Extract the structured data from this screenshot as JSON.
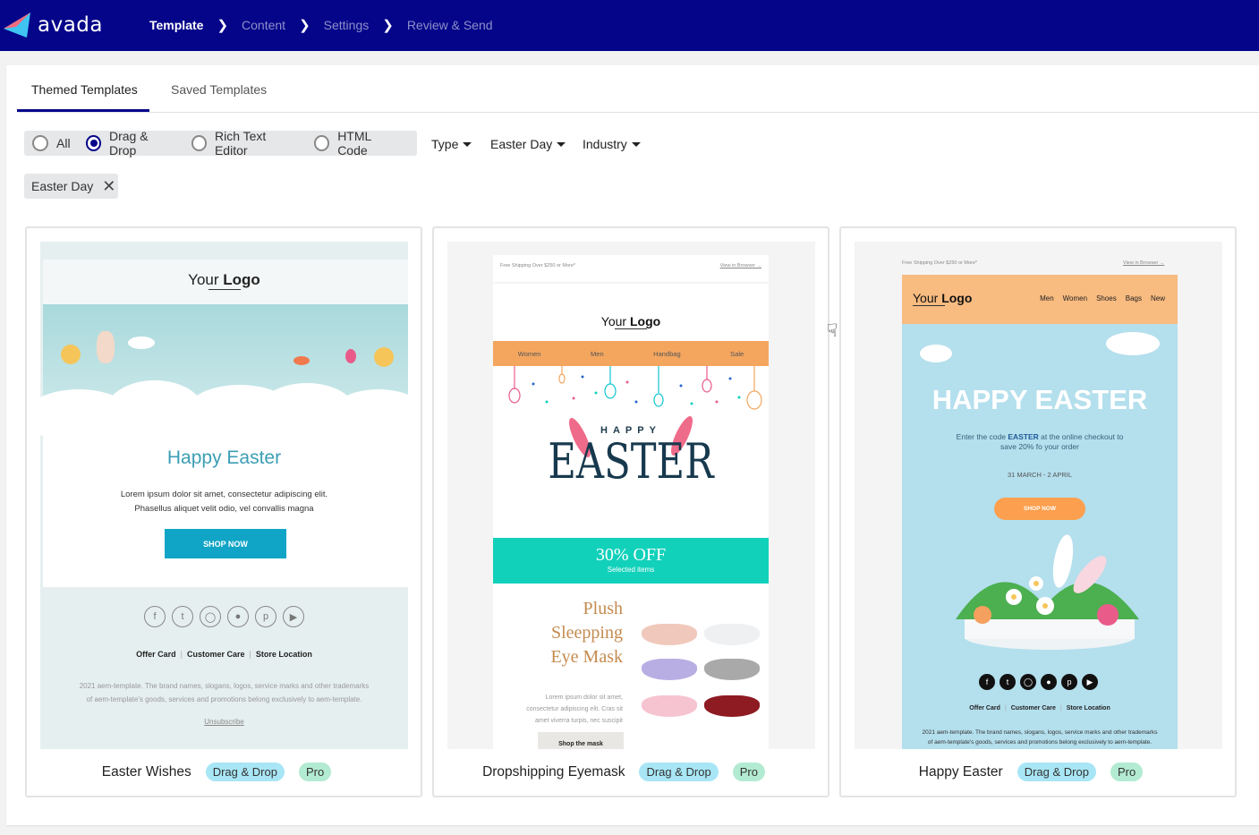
{
  "header": {
    "brand": "avada",
    "steps": [
      {
        "label": "Template",
        "active": true
      },
      {
        "label": "Content",
        "active": false
      },
      {
        "label": "Settings",
        "active": false
      },
      {
        "label": "Review & Send",
        "active": false
      }
    ],
    "colors": {
      "background": "#05058a"
    }
  },
  "tabs": [
    {
      "label": "Themed Templates",
      "active": true
    },
    {
      "label": "Saved Templates",
      "active": false
    }
  ],
  "filters": {
    "editor_types": [
      {
        "label": "All",
        "selected": false
      },
      {
        "label": "Drag & Drop",
        "selected": true
      },
      {
        "label": "Rich Text Editor",
        "selected": false
      },
      {
        "label": "HTML Code",
        "selected": false
      }
    ],
    "dropdowns": [
      "Type",
      "Easter Day",
      "Industry"
    ],
    "active_chip": "Easter Day"
  },
  "templates": [
    {
      "name": "Easter Wishes",
      "editor": "Drag & Drop",
      "tier": "Pro",
      "preview": {
        "logo_a": "Your",
        "logo_b": "Logo",
        "heading": "Happy Easter",
        "text1": "Lorem ipsum dolor sit amet, consectetur adipiscing elit.",
        "text2": "Phasellus aliquet velit odio, vel convallis magna",
        "button": "SHOP NOW",
        "links": [
          "Offer Card",
          "Customer Care",
          "Store Location"
        ],
        "legal1": "2021 aem-template. The brand names, slogans, logos, service marks and other trademarks",
        "legal2": "of aem-template's goods, services and promotions belong exclusively to aem-template.",
        "unsubscribe": "Unsubscribe"
      }
    },
    {
      "name": "Dropshipping Eyemask",
      "editor": "Drag & Drop",
      "tier": "Pro",
      "preview": {
        "shipping": "Free Shipping Over $250 or More*",
        "view": "View in Browser →",
        "logo_a": "Your",
        "logo_b": "Logo",
        "nav": [
          "Women",
          "Men",
          "Handbag",
          "Sale"
        ],
        "happy": "HAPPY",
        "easter": "EASTER",
        "offer": "30% OFF",
        "offer_sub": "Selected items",
        "product_title": [
          "Plush",
          "Sleepping",
          "Eye Mask"
        ],
        "product_text": [
          "Lorem ipsum dolor sit amet,",
          "consectetur adipiscing elit. Cras sit",
          "amet viverra turpis, nec suscipit"
        ],
        "button": "Shop the mask"
      }
    },
    {
      "name": "Happy Easter",
      "editor": "Drag & Drop",
      "tier": "Pro",
      "preview": {
        "shipping": "Free Shipping Over $250 or More*",
        "view": "View in Browser →",
        "logo_a": "Your",
        "logo_b": "Logo",
        "nav": [
          "Men",
          "Women",
          "Shoes",
          "Bags",
          "New"
        ],
        "heading": "HAPPY EASTER",
        "code_pre": "Enter the code ",
        "code": "EASTER",
        "code_post": " at the online checkout to",
        "code_line2": "save 20% fo your order",
        "dates": "31 MARCH - 2 APRIL",
        "button": "SHOP NOW",
        "links": [
          "Offer Card",
          "Customer Care",
          "Store Location"
        ],
        "legal1": "2021 aem-template. The brand names, slogans, logos, service marks and other trademarks",
        "legal2": "of aem-template's goods, services and promotions belong exclusively to aem-template."
      }
    }
  ]
}
